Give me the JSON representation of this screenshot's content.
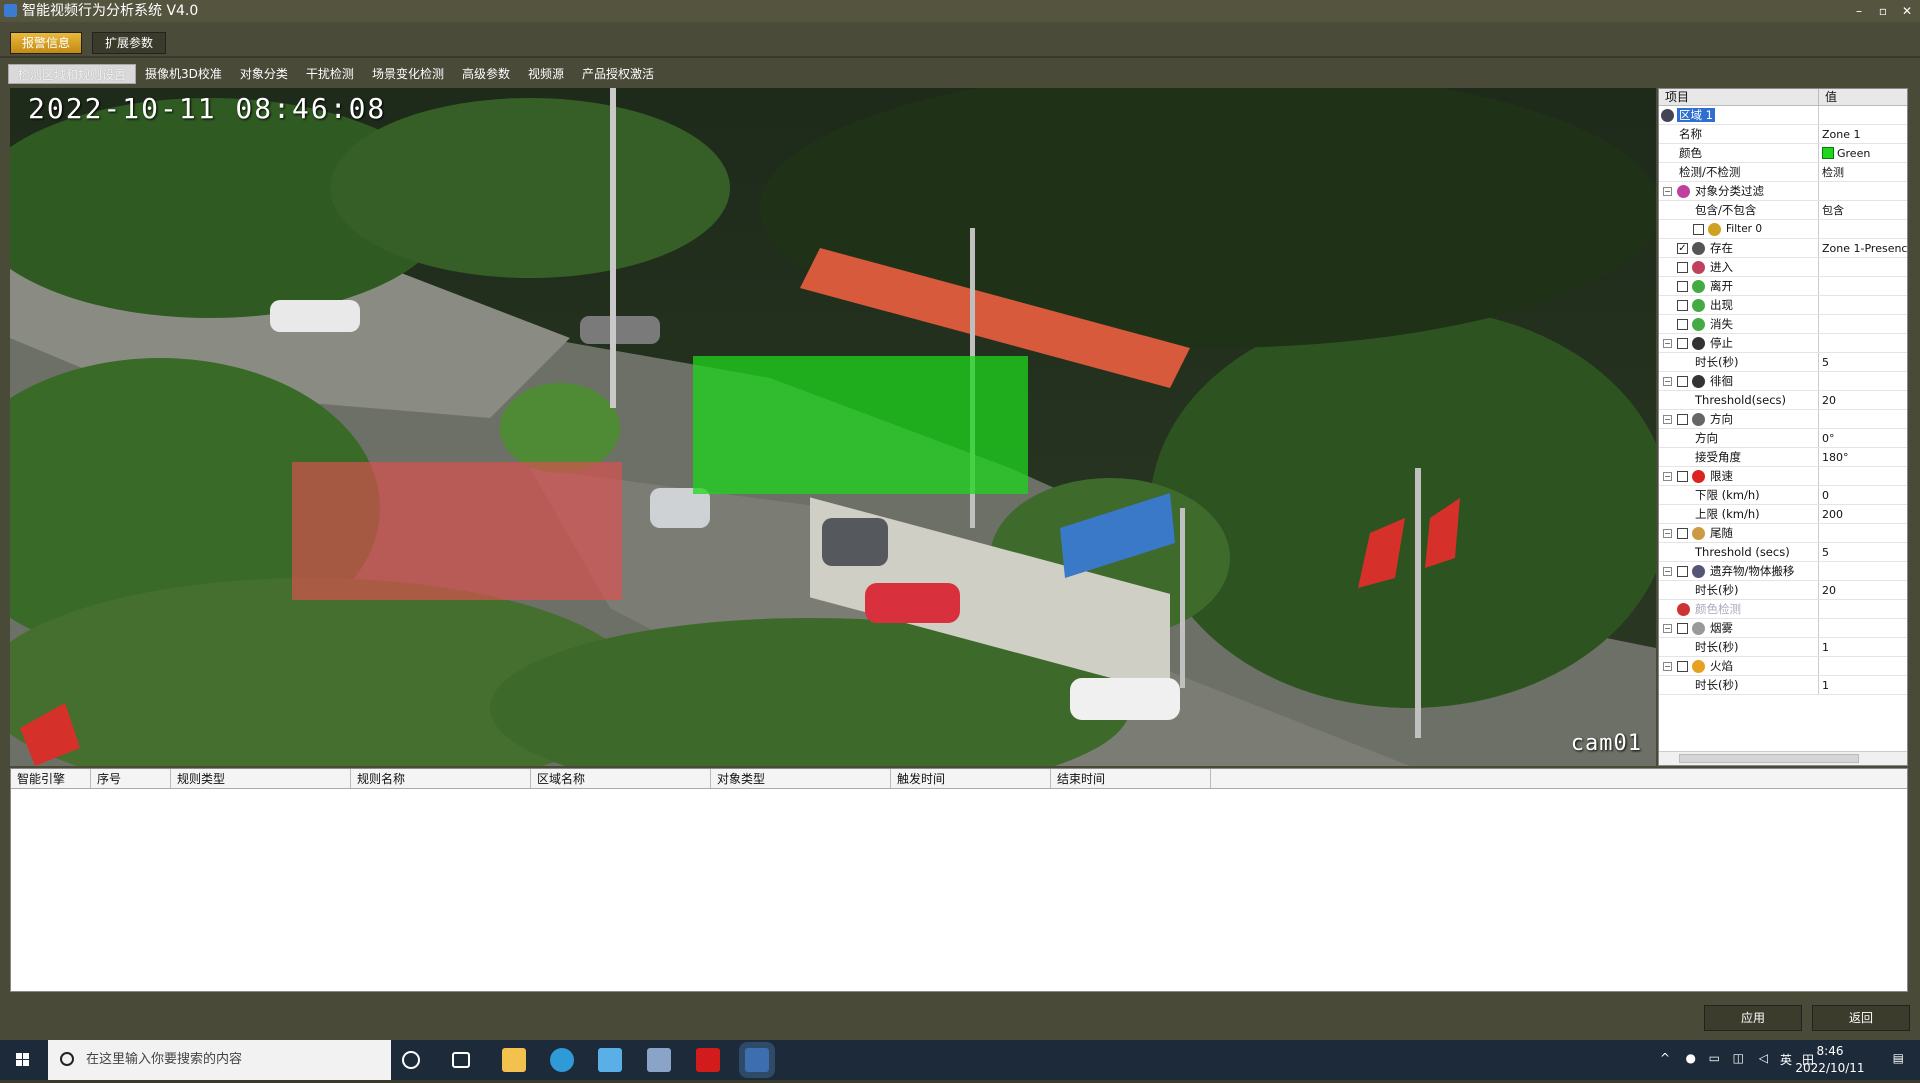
{
  "window": {
    "title": "智能视频行为分析系统 V4.0",
    "controls": [
      "–",
      "▫",
      "✕"
    ]
  },
  "toolbar": {
    "alarm_label": "报警信息",
    "ext_label": "扩展参数"
  },
  "tabs": [
    "检测区域和规则设置",
    "摄像机3D校准",
    "对象分类",
    "干扰检测",
    "场景变化检测",
    "高级参数",
    "视频源",
    "产品授权激活"
  ],
  "video": {
    "timestamp": "2022-10-11 08:46:08",
    "camera": "cam01"
  },
  "props": {
    "header": {
      "item": "项目",
      "value": "值"
    },
    "zone": "区域 1",
    "rows": [
      {
        "name": "名称",
        "value": "Zone 1"
      },
      {
        "name": "颜色",
        "value": "Green"
      },
      {
        "name": "检测/不检测",
        "value": "检测"
      },
      {
        "name": "对象分类过滤",
        "value": ""
      },
      {
        "name": "包含/不包含",
        "value": "包含"
      },
      {
        "name": "Filter 0",
        "value": ""
      },
      {
        "name": "存在",
        "value": "Zone 1-Presence"
      },
      {
        "name": "进入",
        "value": ""
      },
      {
        "name": "离开",
        "value": ""
      },
      {
        "name": "出现",
        "value": ""
      },
      {
        "name": "消失",
        "value": ""
      },
      {
        "name": "停止",
        "value": ""
      },
      {
        "name": "时长(秒)",
        "value": "5"
      },
      {
        "name": "徘徊",
        "value": ""
      },
      {
        "name": "Threshold(secs)",
        "value": "20"
      },
      {
        "name": "方向",
        "value": ""
      },
      {
        "name": "方向",
        "value": "0°"
      },
      {
        "name": "接受角度",
        "value": "180°"
      },
      {
        "name": "限速",
        "value": ""
      },
      {
        "name": "下限 (km/h)",
        "value": "0"
      },
      {
        "name": "上限 (km/h)",
        "value": "200"
      },
      {
        "name": "尾随",
        "value": ""
      },
      {
        "name": "Threshold (secs)",
        "value": "5"
      },
      {
        "name": "遗弃物/物体搬移",
        "value": ""
      },
      {
        "name": "时长(秒)",
        "value": "20"
      },
      {
        "name": "颜色检测",
        "value": ""
      },
      {
        "name": "烟雾",
        "value": ""
      },
      {
        "name": "时长(秒)",
        "value": "1"
      },
      {
        "name": "火焰",
        "value": ""
      },
      {
        "name": "时长(秒)",
        "value": "1"
      }
    ]
  },
  "events": {
    "columns": [
      "智能引擎",
      "序号",
      "规则类型",
      "规则名称",
      "区域名称",
      "对象类型",
      "触发时间",
      "结束时间"
    ]
  },
  "buttons": {
    "apply": "应用",
    "back": "返回"
  },
  "taskbar": {
    "search_placeholder": "在这里输入你要搜索的内容",
    "time": "8:46",
    "date": "2022/10/11",
    "ime": "英",
    "ime2": "田"
  },
  "colors": {
    "zone_green": "#1dd61d",
    "zone_red": "#e05050",
    "accent": "#e8b93a"
  }
}
